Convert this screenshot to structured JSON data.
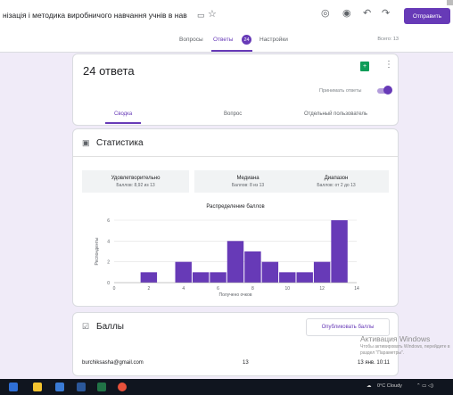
{
  "header": {
    "title": "нізація і методика виробничого навчання учнів в нав",
    "send_label": "Отправить"
  },
  "tabs": [
    {
      "label": "Вопросы"
    },
    {
      "label": "Ответы",
      "badge": "24"
    },
    {
      "label": "Настройки"
    }
  ],
  "total_label": "Всего: 13",
  "responses": {
    "count_label": "24 ответа",
    "accept_label": "Принимать ответы",
    "accept_on": true,
    "subtabs": [
      "Сводка",
      "Вопрос",
      "Отдельный пользователь"
    ]
  },
  "stats": {
    "title": "Статистика",
    "boxes": [
      {
        "title": "Удовлетворительно",
        "value": "Баллов: 8,92 из 13"
      },
      {
        "title": "Медиана",
        "value": "Баллов: 8 из 13"
      },
      {
        "title": "Диапазон",
        "value": "Баллов: от 2 до 13"
      }
    ]
  },
  "chart_data": {
    "type": "bar",
    "title": "Распределение баллов",
    "xlabel": "Получено очков",
    "ylabel": "Респонденты",
    "categories": [
      2,
      3,
      4,
      5,
      6,
      7,
      8,
      9,
      10,
      11,
      12,
      13
    ],
    "values": [
      1,
      0,
      2,
      1,
      1,
      4,
      3,
      2,
      1,
      1,
      2,
      6
    ],
    "xticks": [
      0,
      2,
      4,
      6,
      8,
      10,
      12,
      14
    ],
    "yticks": [
      0,
      2,
      4,
      6
    ],
    "xlim": [
      0,
      14
    ],
    "ylim": [
      0,
      6
    ],
    "color": "#673ab7",
    "grid": true
  },
  "scores": {
    "title": "Баллы",
    "publish_label": "Опубликовать баллы",
    "row": {
      "email": "burchiksasha@gmail.com",
      "score": "13",
      "date": "13 янв. 10:11"
    }
  },
  "watermark": {
    "title": "Активация Windows",
    "subtitle": "Чтобы активировать Windows, перейдите в раздел \"Параметры\"."
  },
  "taskbar": {
    "weather": "0°C Cloudy"
  },
  "colors": {
    "accent": "#673ab7",
    "background": "#f0ebf8"
  }
}
